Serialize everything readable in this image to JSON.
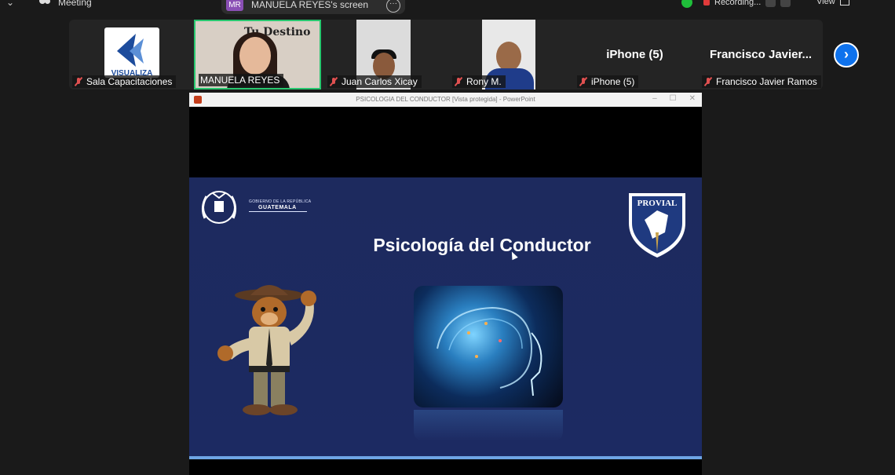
{
  "topbar": {
    "meeting_label": "Meeting",
    "screen_share": {
      "initials": "MR",
      "label": "MANUELA REYES's screen",
      "more": "···"
    },
    "recording_label": "Recording...",
    "view_label": "View"
  },
  "participants": [
    {
      "name": "Sala Capacitaciones",
      "muted": true,
      "logo_text": "VISUALIZA"
    },
    {
      "name": "MANUELA REYES",
      "muted": false,
      "active_speaker": true,
      "background_text": "Tu Destino"
    },
    {
      "name": "Juan Carlos Xicay",
      "muted": true
    },
    {
      "name": "Rony M.",
      "muted": true
    },
    {
      "name": "iPhone (5)",
      "display_name": "iPhone (5)",
      "muted": true
    },
    {
      "name": "Francisco Javier Ramos",
      "display_name": "Francisco  Javier...",
      "muted": true
    }
  ],
  "next_page_icon": "chevron-right-icon",
  "ppt": {
    "window_title": "PSICOLOGIA DEL CONDUCTOR [Vista protegida] - PowerPoint",
    "controls": [
      "–",
      "☐",
      "✕"
    ]
  },
  "slide": {
    "title": "Psicología del Conductor",
    "gov_line1": "GOBIERNO DE LA REPÚBLICA",
    "gov_line2": "GUATEMALA",
    "provial_text": "PROVIAL"
  },
  "colors": {
    "active_border": "#28c76f",
    "next_button": "#0e72ed",
    "slide_bg": "#1c2a62",
    "mic_off": "#e05050"
  }
}
